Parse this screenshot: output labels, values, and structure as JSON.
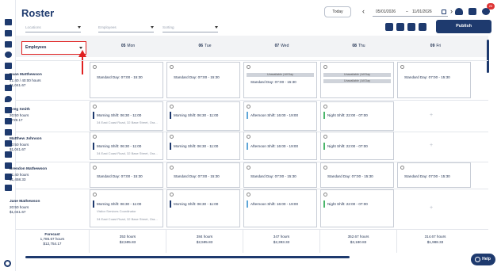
{
  "title": "Roster",
  "filters": {
    "locations": "Locations",
    "employees": "Employees",
    "sorting": "Sorting"
  },
  "today_label": "Today",
  "date_from": "05/01/2026",
  "date_to": "11/01/2026",
  "date_sep": "–",
  "notification_count": "20",
  "publish_label": "Publish",
  "employees_select": "Employees",
  "days": [
    {
      "num": "05",
      "name": "Mon"
    },
    {
      "num": "06",
      "name": "Tue"
    },
    {
      "num": "07",
      "name": "Wed"
    },
    {
      "num": "08",
      "name": "Thu"
    },
    {
      "num": "09",
      "name": "Fri"
    }
  ],
  "employees": [
    {
      "name": "Euan Matthewson",
      "hours": "41:40 / 40:00 hours",
      "cost": "$1,041.67"
    },
    {
      "name": "Greg Smith",
      "hours": "20:50 hours",
      "cost": "$729.17"
    },
    {
      "name": "Matthew Johnson",
      "hours": "20:50 hours",
      "cost": "$1,041.67"
    },
    {
      "name": "Brendon Mathewson",
      "hours": "41:40 hours",
      "cost": "$1,458.33"
    },
    {
      "name": "Jane Mathewson",
      "hours": "20:50 hours",
      "cost": "$1,041.67"
    }
  ],
  "unavailable": "Unavailable | All Day",
  "standard_day": "Standard Day: 07:00 - 15:30",
  "morning_shift": "Morning Shift: 06:30 - 11:00",
  "afternoon_shift": "Afternoon Shift: 16:00 - 19:00",
  "night_shift": "Night Shift: 22:00 - 07:00",
  "address": "34 East Coast Road, 32 Base Street, Ora...",
  "visitor_role": "Visitor Services Coordinator",
  "plus": "+",
  "forecast": {
    "label": "Forecast",
    "hours": "1,786.67 hours",
    "cost": "$12,754.17"
  },
  "forecast_days": [
    {
      "hours": "353 hours",
      "cost": "$2,595.83"
    },
    {
      "hours": "384 hours",
      "cost": "$2,595.83"
    },
    {
      "hours": "347 hours",
      "cost": "$2,393.33"
    },
    {
      "hours": "352.67 hours",
      "cost": "$3,180.83"
    },
    {
      "hours": "314.67 hours",
      "cost": "$1,988.33"
    }
  ],
  "help_label": "Help",
  "colors": {
    "primary": "#1e3a6e",
    "morning": "#1e3a6e",
    "afternoon": "#5fa6d8",
    "night": "#4ab56b",
    "highlight": "#e02020"
  }
}
